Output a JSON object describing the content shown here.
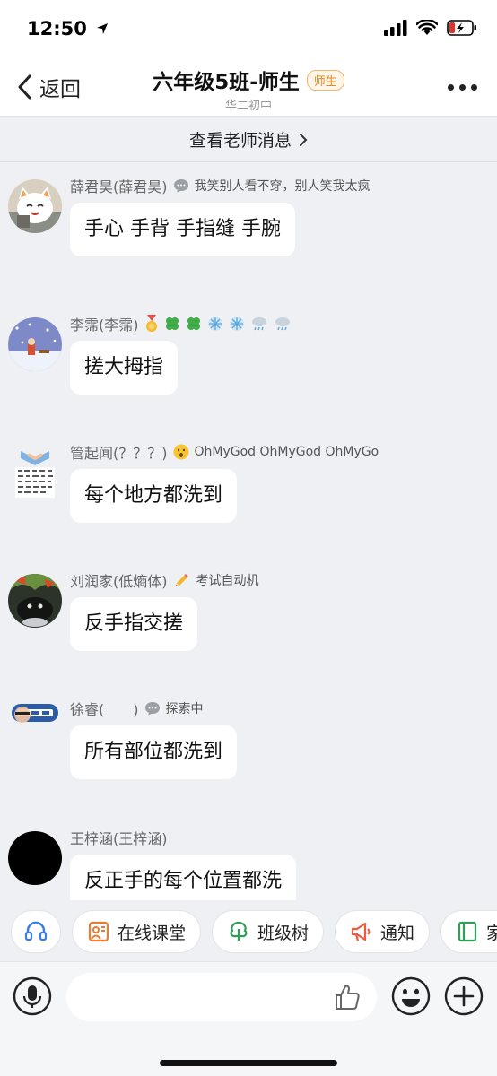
{
  "status_bar": {
    "time": "12:50"
  },
  "nav": {
    "back_label": "返回",
    "title": "六年级5班-师生",
    "badge": "师生",
    "subtitle": "华二初中"
  },
  "teacher_bar": {
    "label": "查看老师消息"
  },
  "messages": [
    {
      "name": "薛君昊(薛君昊)",
      "signature": "我笑别人看不穿，别人笑我太疯",
      "text": "手心 手背 手指缝 手腕"
    },
    {
      "name": "李霈(李霈)",
      "signature": "",
      "text": "搓大拇指"
    },
    {
      "name": "管起闻(？？？)",
      "signature": "OhMyGod OhMyGod OhMyGo",
      "text": "每个地方都洗到"
    },
    {
      "name": "刘润家(低熵体)",
      "signature": "考试自动机",
      "text": "反手指交搓"
    },
    {
      "name": "徐睿(　　)",
      "signature": "探索中",
      "text": "所有部位都洗到"
    },
    {
      "name": "王梓涵(王梓涵)",
      "signature": "",
      "text": "反正手的每个位置都洗"
    }
  ],
  "quick_actions": [
    {
      "label": "",
      "icon": "headset-icon"
    },
    {
      "label": "在线课堂",
      "icon": "online-class-icon"
    },
    {
      "label": "班级树",
      "icon": "tree-icon"
    },
    {
      "label": "通知",
      "icon": "megaphone-icon"
    },
    {
      "label": "家",
      "icon": "book-icon"
    }
  ],
  "input": {
    "placeholder": ""
  },
  "colors": {
    "accent_orange": "#e8891c",
    "tree_green": "#2f9e56",
    "notice_red": "#ef5a3c",
    "class_orange": "#f07a33"
  }
}
